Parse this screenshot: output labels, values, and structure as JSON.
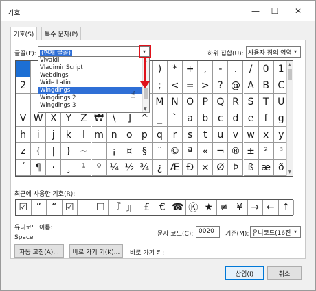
{
  "window": {
    "title": "기호",
    "minimize": "—",
    "maximize": "☐",
    "close": "✕"
  },
  "tabs": [
    "기호(S)",
    "특수 문자(P)"
  ],
  "font": {
    "label": "글꼴(F):",
    "value": "(현재 글꼴)"
  },
  "subset": {
    "label": "하위 집합(U):",
    "value": "사용자 정의 영역"
  },
  "font_list": [
    "Vivaldi",
    "Vladimir Script",
    "Webdings",
    "Wide Latin",
    "Wingdings",
    "Wingdings 2",
    "Wingdings 3"
  ],
  "font_list_selected": "Wingdings",
  "grid_rows": [
    [
      " ",
      "",
      "",
      "",
      "",
      "",
      "",
      "",
      "",
      ")",
      "*",
      "+",
      ",",
      "-",
      ".",
      "/",
      "0",
      "1"
    ],
    [
      "2",
      "",
      "",
      "",
      "",
      "",
      "",
      "",
      "",
      ";",
      "<",
      "=",
      ">",
      "?",
      "@",
      "A",
      "B",
      "C"
    ],
    [
      "",
      "",
      "",
      "",
      "",
      "",
      "",
      "",
      "",
      "M",
      "N",
      "O",
      "P",
      "Q",
      "R",
      "S",
      "T",
      "U"
    ],
    [
      "V",
      "W",
      "X",
      "Y",
      "Z",
      "[",
      "\\",
      "]",
      "^",
      "_",
      "`",
      "a",
      "b",
      "c",
      "d",
      "e",
      "f",
      "g"
    ],
    [
      "h",
      "i",
      "j",
      "k",
      "l",
      "m",
      "n",
      "o",
      "p",
      "q",
      "r",
      "s",
      "t",
      "u",
      "v",
      "w",
      "x",
      "y"
    ],
    [
      "z",
      "{",
      "|",
      "}",
      "~",
      " ",
      "¡",
      "¤",
      "§",
      "¨",
      "©",
      "ª",
      "«",
      "¬",
      "®",
      "±",
      "²",
      "³"
    ],
    [
      "´",
      "¶",
      "·",
      "¸",
      "¹",
      "º",
      "¼",
      "½",
      "¾",
      "¿",
      "Æ",
      "Ð",
      "×",
      "Ø",
      "Þ",
      "ß",
      "æ",
      "ð"
    ]
  ],
  "grid_partial": {
    "r3c5": "₩",
    "r3c7": "]",
    "r4c0": "h"
  },
  "recent": {
    "label": "최근에 사용한 기호(R):",
    "symbols": [
      "☑",
      "”",
      "“",
      "☑",
      "",
      "☐",
      "『",
      "』",
      "£",
      "€",
      "☎",
      "Ⓚ",
      "★",
      "≠",
      "¥",
      "→",
      "←",
      "↑"
    ]
  },
  "unicode_name": {
    "label": "유니코드 이름:",
    "value": "Space"
  },
  "char_code": {
    "label": "문자 코드(C):",
    "value": "0020"
  },
  "from": {
    "label": "기준(M):",
    "value": "유니코드(16진수)"
  },
  "buttons": {
    "autocorrect": "자동 고침(A)...",
    "shortcut_key": "바로 가기 키(K)...",
    "shortcut_label": "바로 가기 키:",
    "insert": "삽입(I)",
    "cancel": "취소"
  }
}
